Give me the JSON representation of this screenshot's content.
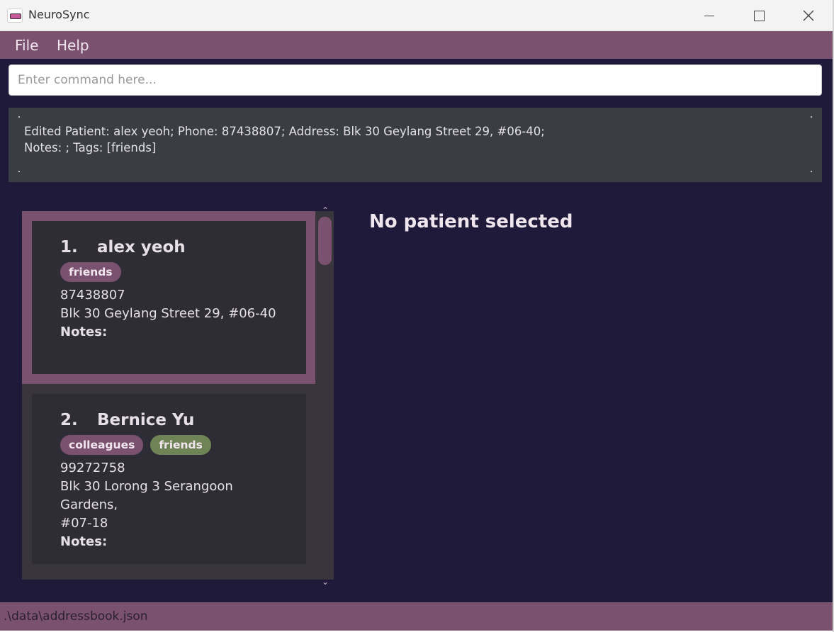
{
  "window": {
    "title": "NeuroSync"
  },
  "menu": {
    "file": "File",
    "help": "Help"
  },
  "command": {
    "placeholder": "Enter command here..."
  },
  "result": {
    "line1": "Edited Patient: alex yeoh; Phone: 87438807; Address: Blk 30 Geylang Street 29, #06-40;",
    "line2": "Notes: ; Tags: [friends]"
  },
  "patients": [
    {
      "index": "1.",
      "name": "alex yeoh",
      "tags": [
        "friends"
      ],
      "phone": "87438807",
      "address": "Blk 30 Geylang Street 29, #06-40",
      "notes_label": "Notes:"
    },
    {
      "index": "2.",
      "name": "Bernice Yu",
      "tags": [
        "colleagues",
        "friends"
      ],
      "phone": "99272758",
      "address_line1": "Blk 30 Lorong 3 Serangoon Gardens,",
      "address_line2": "#07-18",
      "notes_label": "Notes:"
    }
  ],
  "detail": {
    "empty_text": "No patient selected"
  },
  "status": {
    "file_path": ".\\data\\addressbook.json"
  },
  "colors": {
    "accent": "#7a526f",
    "background": "#201a3a",
    "card": "#2e2d35",
    "tag_green": "#6f8456"
  },
  "icons": {
    "app": "app-icon",
    "minimize": "minimize-icon",
    "maximize": "maximize-icon",
    "close": "close-icon",
    "scroll_up": "chevron-up-icon",
    "scroll_down": "chevron-down-icon"
  }
}
